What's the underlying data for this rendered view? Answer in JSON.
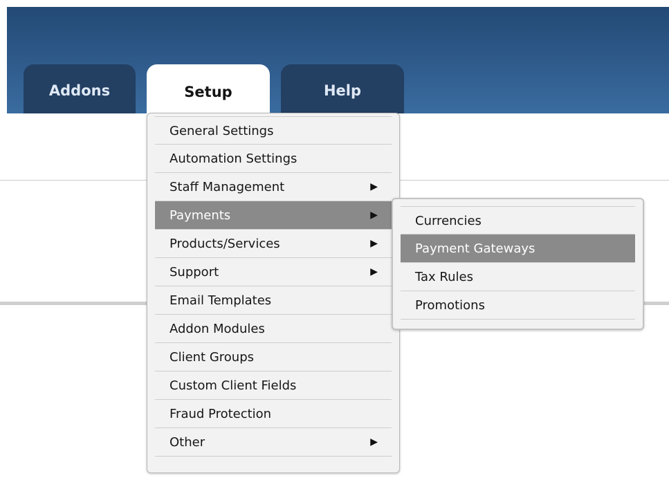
{
  "tabs": [
    {
      "label": "Addons",
      "active": false
    },
    {
      "label": "Setup",
      "active": true
    },
    {
      "label": "Help",
      "active": false
    }
  ],
  "setup_menu": {
    "items": [
      {
        "label": "General Settings",
        "has_submenu": false
      },
      {
        "label": "Automation Settings",
        "has_submenu": false
      },
      {
        "label": "Staff Management",
        "has_submenu": true
      },
      {
        "label": "Payments",
        "has_submenu": true,
        "highlighted": true
      },
      {
        "label": "Products/Services",
        "has_submenu": true
      },
      {
        "label": "Support",
        "has_submenu": true
      },
      {
        "label": "Email Templates",
        "has_submenu": false
      },
      {
        "label": "Addon Modules",
        "has_submenu": false
      },
      {
        "label": "Client Groups",
        "has_submenu": false
      },
      {
        "label": "Custom Client Fields",
        "has_submenu": false
      },
      {
        "label": "Fraud Protection",
        "has_submenu": false
      },
      {
        "label": "Other",
        "has_submenu": true
      }
    ]
  },
  "payments_submenu": {
    "items": [
      {
        "label": "Currencies",
        "highlighted": false
      },
      {
        "label": "Payment Gateways",
        "highlighted": true
      },
      {
        "label": "Tax Rules",
        "highlighted": false
      },
      {
        "label": "Promotions",
        "highlighted": false
      }
    ]
  },
  "icons": {
    "submenu_arrow": "caret-right-icon"
  },
  "colors": {
    "header_blue": "#2d5888",
    "tab_dark": "#233f62",
    "highlight_gray": "#8a8a8a",
    "menu_bg": "#f2f2f2"
  }
}
